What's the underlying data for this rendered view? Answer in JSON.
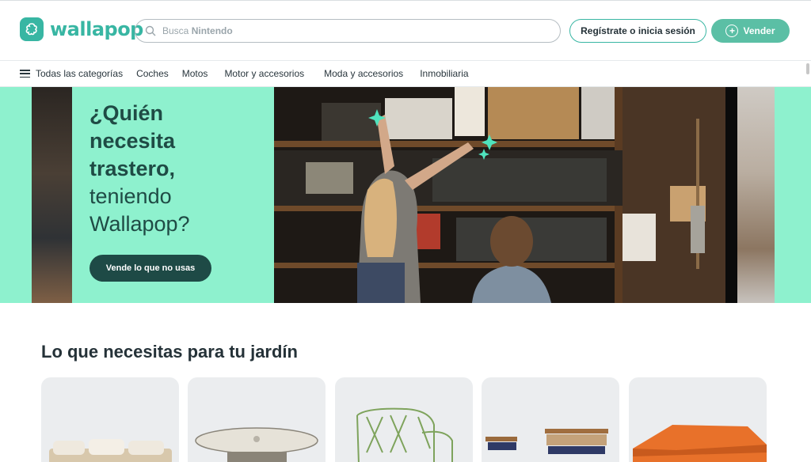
{
  "header": {
    "logo_text": "wallapop",
    "search": {
      "placeholder_prefix": "Busca",
      "placeholder_term": "Nintendo"
    },
    "login_label": "Regístrate o inicia sesión",
    "sell_label": "Vender"
  },
  "nav": {
    "all_categories": "Todas las categorías",
    "items": [
      "Coches",
      "Motos",
      "Motor y accesorios",
      "Moda y accesorios",
      "Inmobiliaria"
    ]
  },
  "banner": {
    "headline_strong": [
      "¿Quién",
      "necesita",
      "trastero,"
    ],
    "headline_light": [
      "teniendo",
      "Wallapop?"
    ],
    "cta_label": "Vende lo que no usas"
  },
  "section": {
    "title": "Lo que necesitas para tu jardín",
    "cards": [
      "sofa-set",
      "round-table",
      "wire-chair",
      "bench-set",
      "orange-gazebo"
    ]
  },
  "colors": {
    "brand": "#38b6a3",
    "banner_bg": "#8ef1ce",
    "cta_bg": "#1e4a46"
  }
}
